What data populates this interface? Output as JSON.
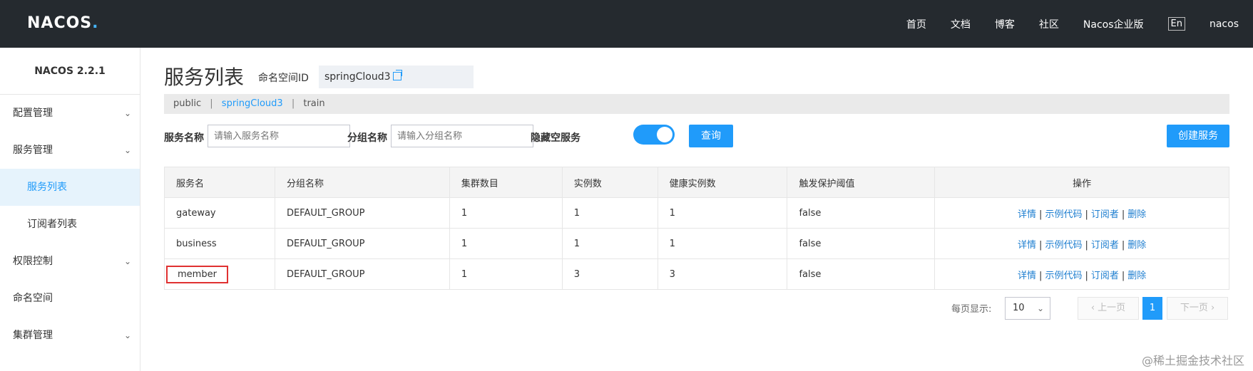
{
  "header": {
    "logo": "NACOS",
    "logo_dot": ".",
    "nav": [
      "首页",
      "文档",
      "博客",
      "社区",
      "Nacos企业版"
    ],
    "lang": "En",
    "user": "nacos"
  },
  "sidebar": {
    "version": "NACOS 2.2.1",
    "items": [
      {
        "label": "配置管理"
      },
      {
        "label": "服务管理"
      },
      {
        "label": "服务列表"
      },
      {
        "label": "订阅者列表"
      },
      {
        "label": "权限控制"
      },
      {
        "label": "命名空间"
      },
      {
        "label": "集群管理"
      }
    ]
  },
  "main": {
    "title": "服务列表",
    "namespace_label": "命名空间ID",
    "namespace_value": "springCloud3",
    "namespaces": [
      "public",
      "springCloud3",
      "train"
    ],
    "search": {
      "service_label": "服务名称",
      "service_placeholder": "请输入服务名称",
      "group_label": "分组名称",
      "group_placeholder": "请输入分组名称",
      "hide_empty_label": "隐藏空服务",
      "hide_empty_on": true,
      "query_button": "查询",
      "create_button": "创建服务"
    },
    "table": {
      "headers": [
        "服务名",
        "分组名称",
        "集群数目",
        "实例数",
        "健康实例数",
        "触发保护阈值",
        "操作"
      ],
      "rows": [
        {
          "name": "gateway",
          "group": "DEFAULT_GROUP",
          "clusters": "1",
          "instances": "1",
          "healthy": "1",
          "threshold": "false"
        },
        {
          "name": "business",
          "group": "DEFAULT_GROUP",
          "clusters": "1",
          "instances": "1",
          "healthy": "1",
          "threshold": "false"
        },
        {
          "name": "member",
          "group": "DEFAULT_GROUP",
          "clusters": "1",
          "instances": "3",
          "healthy": "3",
          "threshold": "false"
        }
      ],
      "actions": [
        "详情",
        "示例代码",
        "订阅者",
        "删除"
      ],
      "action_sep": "|"
    },
    "pagination": {
      "page_size_label": "每页显示:",
      "page_size": "10",
      "prev": "上一页",
      "next": "下一页",
      "current": "1"
    }
  },
  "watermark": "@稀土掘金技术社区"
}
